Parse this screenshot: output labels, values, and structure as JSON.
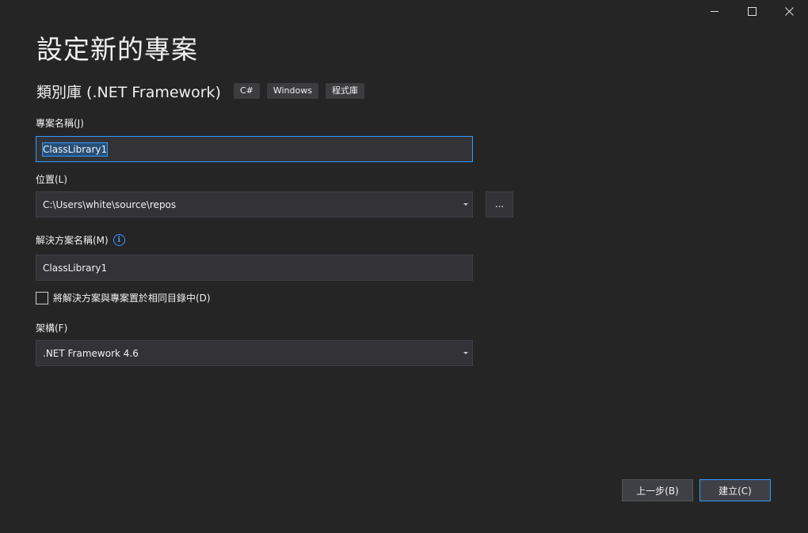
{
  "window": {
    "title": "設定新的專案",
    "controls": {
      "minimize": "minimize-icon",
      "maximize": "maximize-icon",
      "close": "close-icon"
    }
  },
  "template": {
    "name": "類別庫 (.NET Framework)",
    "tags": [
      "C#",
      "Windows",
      "程式庫"
    ]
  },
  "project_name": {
    "label": "專案名稱(J)",
    "value": "ClassLibrary1"
  },
  "location": {
    "label": "位置(L)",
    "value": "C:\\Users\\white\\source\\repos",
    "browse_label": "..."
  },
  "solution_name": {
    "label": "解決方案名稱(M)",
    "info_icon": "info-icon",
    "value": "ClassLibrary1"
  },
  "same_directory": {
    "label": "將解決方案與專案置於相同目錄中(D)",
    "checked": false
  },
  "framework": {
    "label": "架構(F)",
    "value": ".NET Framework 4.6"
  },
  "buttons": {
    "back": "上一步(B)",
    "create": "建立(C)"
  },
  "colors": {
    "background": "#252526",
    "input_background": "#333337",
    "accent": "#3399ff"
  }
}
